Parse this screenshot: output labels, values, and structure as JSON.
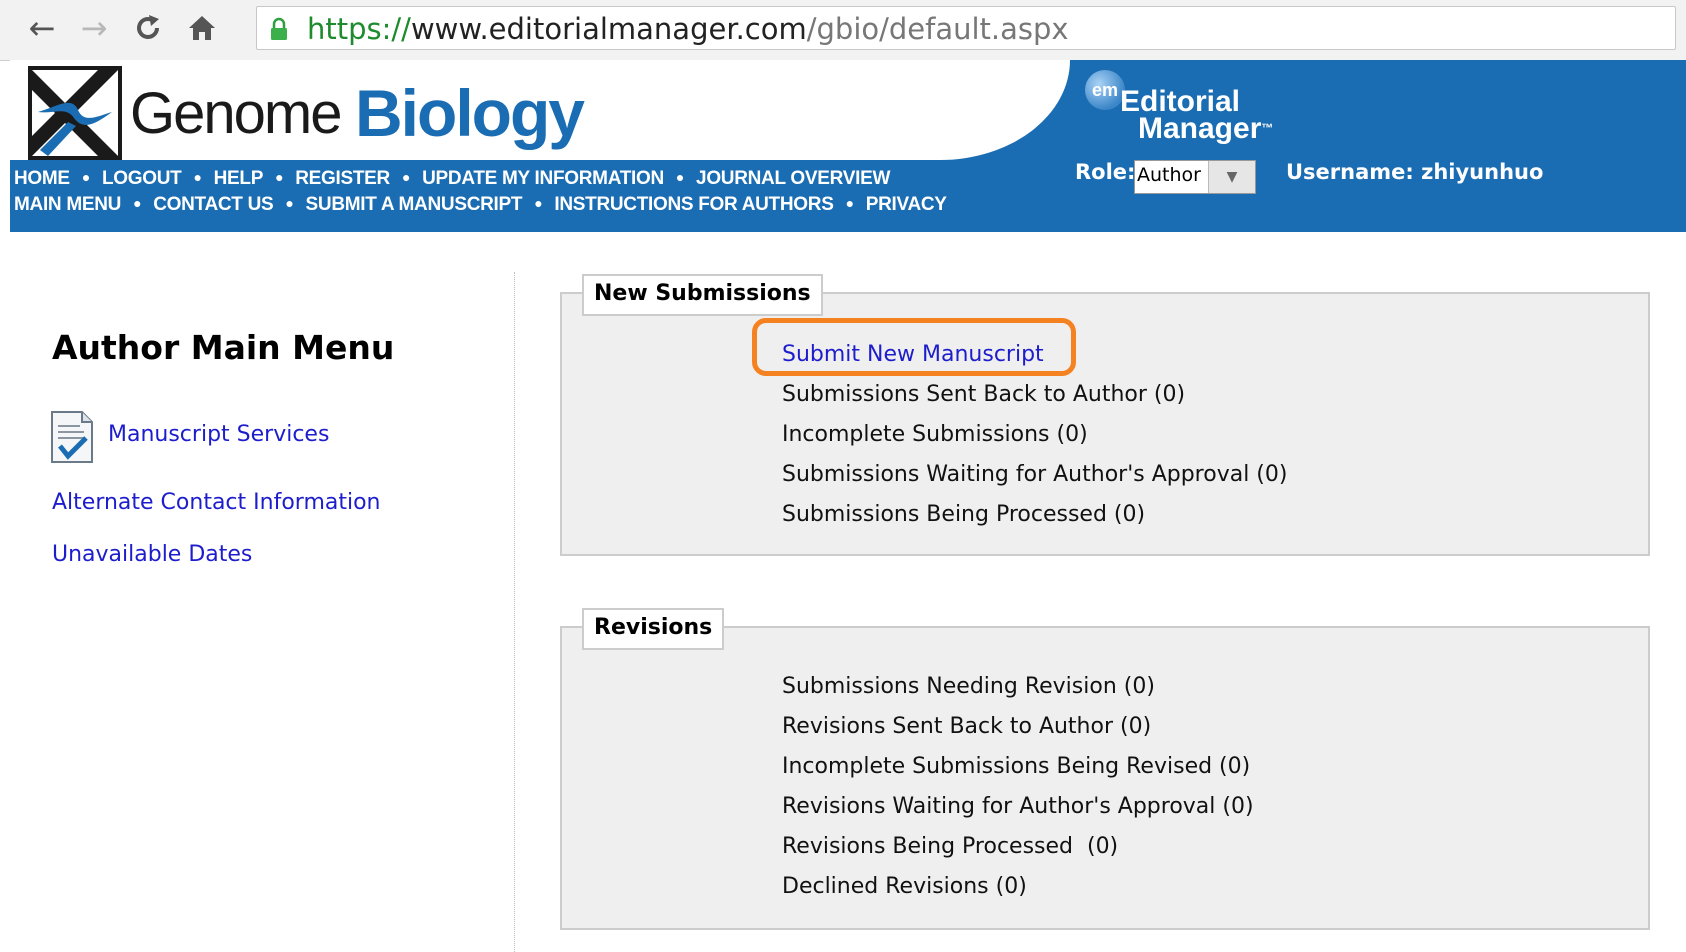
{
  "browser": {
    "url": {
      "scheme": "https://",
      "host": "www.editorialmanager.com",
      "path": "/gbio/default.aspx"
    },
    "icons": {
      "back": "arrow-left",
      "forward": "arrow-right",
      "reload": "reload",
      "home": "home",
      "secure": "lock"
    }
  },
  "header": {
    "brand_word1": "Genome",
    "brand_word2": "Biology",
    "em_badge": "em",
    "em_line1": "Editorial",
    "em_line2": "Manager",
    "em_tm": "™",
    "nav_row1": [
      "HOME",
      "LOGOUT",
      "HELP",
      "REGISTER",
      "UPDATE MY INFORMATION",
      "JOURNAL OVERVIEW"
    ],
    "nav_row2": [
      "MAIN MENU",
      "CONTACT US",
      "SUBMIT A MANUSCRIPT",
      "INSTRUCTIONS FOR AUTHORS",
      "PRIVACY"
    ],
    "role_label": "Role:",
    "role_value": "Author",
    "username_text": "Username: zhiyunhuo",
    "colors": {
      "brand_blue": "#1b6db3",
      "logo_dark": "#1a1a1a"
    }
  },
  "sidebar": {
    "title": "Author Main Menu",
    "manuscript_services": "Manuscript Services",
    "alternate_contact": "Alternate Contact Information",
    "unavailable_dates": "Unavailable Dates",
    "icon": "document-check-icon"
  },
  "new_submissions": {
    "legend": "New Submissions",
    "items": [
      "Submit New Manuscript",
      "Submissions Sent Back to Author (0)",
      "Incomplete Submissions (0)",
      "Submissions Waiting for Author's Approval (0)",
      "Submissions Being Processed (0)"
    ],
    "highlight_color": "#f58220"
  },
  "revisions": {
    "legend": "Revisions",
    "items": [
      "Submissions Needing Revision (0)",
      "Revisions Sent Back to Author (0)",
      "Incomplete Submissions Being Revised (0)",
      "Revisions Waiting for Author's Approval (0)",
      "Revisions Being Processed  (0)",
      "Declined Revisions (0)"
    ]
  },
  "colors": {
    "link": "#1d1dcc",
    "box_bg": "#efefef",
    "box_border": "#cccccc"
  }
}
